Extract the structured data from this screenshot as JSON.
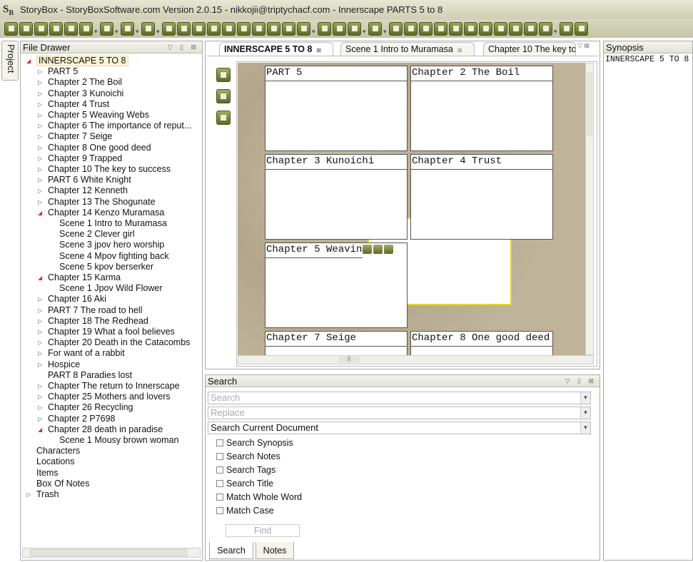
{
  "window": {
    "title": "StoryBox - StoryBoxSoftware.com Version 2.0.15 -  nikkojii@triptychacf.com - Innerscape PARTS 5 to 8",
    "logo": "SB"
  },
  "toolbar": {
    "buttons": [
      "select",
      "import",
      "download",
      "upload",
      "print",
      "new-document",
      "|",
      "page",
      "|",
      "undo",
      "|",
      "redo",
      "|",
      "doc",
      "copy-doc",
      "edit",
      "info",
      "flag",
      "chart",
      "note",
      "search",
      "check",
      "merge",
      "|",
      "grid",
      "zoom",
      "pen",
      "|",
      "pipe",
      "|",
      "rotate-left",
      "rotate-right",
      "cut",
      "copy",
      "paste",
      "bold",
      "italic",
      "underline",
      "align-left",
      "align-center",
      "align-right",
      "|",
      "help",
      "pin"
    ]
  },
  "project_tab": "Project",
  "file_drawer": {
    "title": "File Drawer",
    "items": [
      {
        "label": "INNERSCAPE 5 TO 8",
        "level": 0,
        "arrow": "open",
        "selected": true
      },
      {
        "label": "PART 5",
        "level": 1,
        "arrow": "closed"
      },
      {
        "label": "Chapter 2 The Boil",
        "level": 1,
        "arrow": "closed"
      },
      {
        "label": "Chapter 3 Kunoichi",
        "level": 1,
        "arrow": "closed"
      },
      {
        "label": "Chapter 4 Trust",
        "level": 1,
        "arrow": "closed"
      },
      {
        "label": "Chapter 5 Weaving Webs",
        "level": 1,
        "arrow": "closed"
      },
      {
        "label": "Chapter 6 The importance of reput...",
        "level": 1,
        "arrow": "closed"
      },
      {
        "label": "Chapter 7 Seige",
        "level": 1,
        "arrow": "closed"
      },
      {
        "label": "Chapter 8 One good deed",
        "level": 1,
        "arrow": "closed"
      },
      {
        "label": "Chapter 9 Trapped",
        "level": 1,
        "arrow": "closed"
      },
      {
        "label": "Chapter 10 The key to success",
        "level": 1,
        "arrow": "closed"
      },
      {
        "label": "PART 6 White Knight",
        "level": 1,
        "arrow": "closed"
      },
      {
        "label": "Chapter 12 Kenneth",
        "level": 1,
        "arrow": "closed"
      },
      {
        "label": "Chapter 13 The Shogunate",
        "level": 1,
        "arrow": "closed"
      },
      {
        "label": "Chapter 14 Kenzo Muramasa",
        "level": 1,
        "arrow": "open"
      },
      {
        "label": "Scene 1 Intro to Muramasa",
        "level": 2
      },
      {
        "label": "Scene 2 Clever girl",
        "level": 2
      },
      {
        "label": "Scene 3 jpov hero worship",
        "level": 2
      },
      {
        "label": "Scene 4 Mpov fighting back",
        "level": 2
      },
      {
        "label": "Scene 5 kpov berserker",
        "level": 2
      },
      {
        "label": "Chapter 15 Karma",
        "level": 1,
        "arrow": "open"
      },
      {
        "label": "Scene 1 Jpov Wild Flower",
        "level": 2
      },
      {
        "label": "Chapter 16 Aki",
        "level": 1,
        "arrow": "closed"
      },
      {
        "label": "PART 7 The road to hell",
        "level": 1,
        "arrow": "closed"
      },
      {
        "label": "Chapter 18 The Redhead",
        "level": 1,
        "arrow": "closed"
      },
      {
        "label": "Chapter 19 What a fool believes",
        "level": 1,
        "arrow": "closed"
      },
      {
        "label": "Chapter 20 Death in the Catacombs",
        "level": 1,
        "arrow": "closed"
      },
      {
        "label": "For want of a rabbit",
        "level": 1,
        "arrow": "closed"
      },
      {
        "label": "Hospice",
        "level": 1,
        "arrow": "closed"
      },
      {
        "label": "PART 8 Paradies lost",
        "level": 1
      },
      {
        "label": "Chapter The return to Innerscape",
        "level": 1,
        "arrow": "closed"
      },
      {
        "label": "Chapter 25 Mothers and lovers",
        "level": 1,
        "arrow": "closed"
      },
      {
        "label": "Chapter 26 Recycling",
        "level": 1,
        "arrow": "closed"
      },
      {
        "label": "Chapter 2 P7698",
        "level": 1,
        "arrow": "closed"
      },
      {
        "label": "Chapter 28 death in paradise",
        "level": 1,
        "arrow": "open"
      },
      {
        "label": "Scene 1 Mousy brown woman",
        "level": 2
      },
      {
        "label": "Characters",
        "level": 0
      },
      {
        "label": "Locations",
        "level": 0
      },
      {
        "label": "Items",
        "level": 0
      },
      {
        "label": "Box Of Notes",
        "level": 0
      },
      {
        "label": "Trash",
        "level": 0,
        "arrow": "closed"
      }
    ]
  },
  "editor": {
    "tabs": [
      {
        "label": "INNERSCAPE 5 TO 8",
        "active": true
      },
      {
        "label": "Scene 1 Intro to Muramasa"
      },
      {
        "label": "Chapter 10 The key to success"
      }
    ],
    "side_icons": [
      "document-icon",
      "comment-icon",
      "list-icon"
    ],
    "cards": [
      "PART 5",
      "Chapter 2 The Boil",
      "Chapter 3 Kunoichi",
      "Chapter 4 Trust",
      "Chapter 5 Weaving Webs",
      "Chapter 8 One good deed",
      "Chapter 7 Seige",
      "Chapter 8 One good deed"
    ]
  },
  "search": {
    "title": "Search",
    "search_placeholder": "Search",
    "replace_placeholder": "Replace",
    "scope": "Search Current Document",
    "options": [
      "Search Synopsis",
      "Search Notes",
      "Search Tags",
      "Search Title",
      "Match Whole Word",
      "Match Case"
    ],
    "find_label": "Find",
    "tabs": [
      "Search",
      "Notes"
    ]
  },
  "synopsis": {
    "title": "Synopsis",
    "text": "INNERSCAPE 5 TO 8"
  },
  "colors": {
    "toolbar_button": "#6f7b34",
    "selected_item": "#fdf4d8",
    "cork": "#b8ab92",
    "drag_card_border": "#e8d820"
  }
}
